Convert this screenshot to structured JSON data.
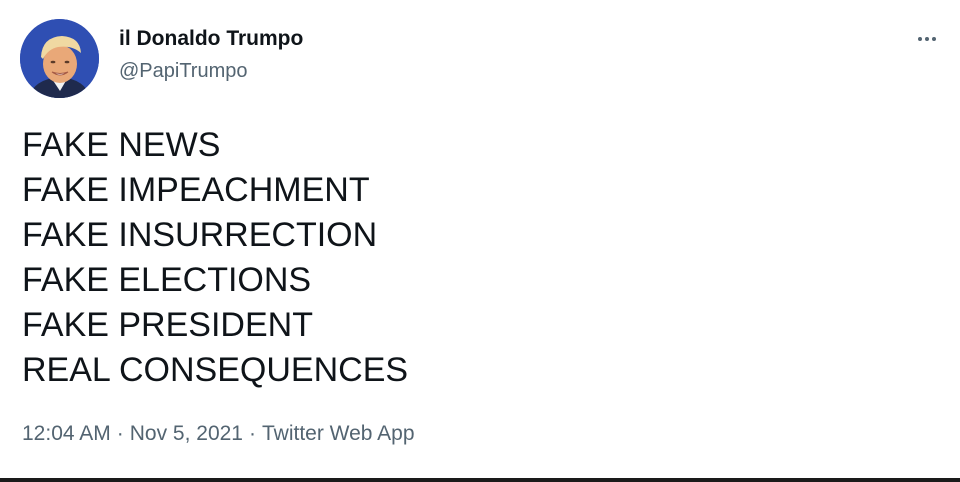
{
  "user": {
    "display_name": "il Donaldo Trumpo",
    "handle": "@PapiTrumpo",
    "avatar_icon": "profile-avatar"
  },
  "menu": {
    "icon": "more-horizontal-icon"
  },
  "tweet": {
    "lines": [
      "FAKE NEWS",
      "FAKE IMPEACHMENT",
      "FAKE INSURRECTION",
      "FAKE ELECTIONS",
      "FAKE PRESIDENT",
      "REAL CONSEQUENCES"
    ]
  },
  "meta": {
    "time": "12:04 AM",
    "date": "Nov 5, 2021",
    "source": "Twitter Web App",
    "separator": "·"
  },
  "colors": {
    "text_primary": "#0f1419",
    "text_secondary": "#536471",
    "background": "#ffffff"
  }
}
